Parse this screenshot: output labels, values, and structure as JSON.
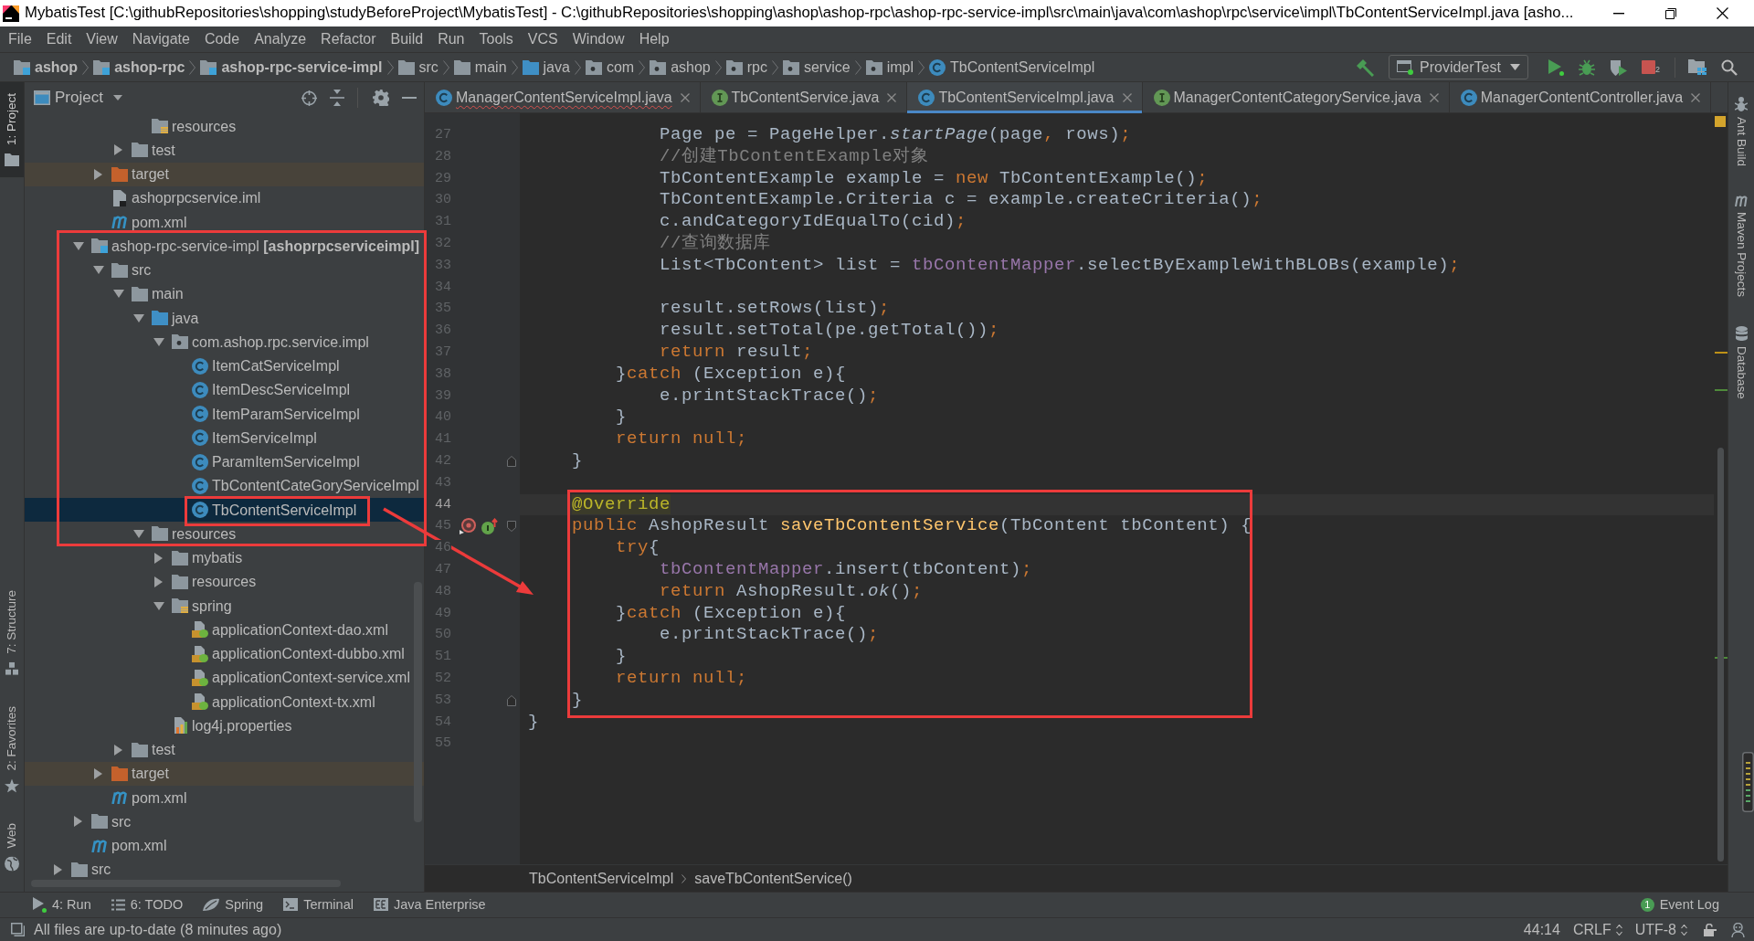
{
  "window": {
    "title": "MybatisTest [C:\\githubRepositories\\shopping\\studyBeforeProject\\MybatisTest] - C:\\githubRepositories\\shopping\\ashop\\ashop-rpc\\ashop-rpc-service-impl\\src\\main\\java\\com\\ashop\\rpc\\service\\impl\\TbContentServiceImpl.java [asho..."
  },
  "menu": [
    "File",
    "Edit",
    "View",
    "Navigate",
    "Code",
    "Analyze",
    "Refactor",
    "Build",
    "Run",
    "Tools",
    "VCS",
    "Window",
    "Help"
  ],
  "navigation_bar": {
    "path": [
      {
        "label": "ashop",
        "kind": "module"
      },
      {
        "label": "ashop-rpc",
        "kind": "module"
      },
      {
        "label": "ashop-rpc-service-impl",
        "kind": "module"
      },
      {
        "label": "src",
        "kind": "folder"
      },
      {
        "label": "main",
        "kind": "folder"
      },
      {
        "label": "java",
        "kind": "source-root"
      },
      {
        "label": "com",
        "kind": "package"
      },
      {
        "label": "ashop",
        "kind": "package"
      },
      {
        "label": "rpc",
        "kind": "package"
      },
      {
        "label": "service",
        "kind": "package"
      },
      {
        "label": "impl",
        "kind": "package"
      },
      {
        "label": "TbContentServiceImpl",
        "kind": "class"
      }
    ]
  },
  "toolbar": {
    "run_configuration": "ProviderTest",
    "running_count": "2"
  },
  "left_tool_strip": [
    {
      "label": "1: Project",
      "kind": "project",
      "selected": true
    },
    {
      "label": "7: Structure",
      "kind": "structure",
      "selected": false
    },
    {
      "label": "2: Favorites",
      "kind": "favorites",
      "selected": false
    },
    {
      "label": "Web",
      "kind": "web",
      "selected": false
    }
  ],
  "project_panel": {
    "title": "Project",
    "tree": [
      {
        "children": [
          {
            "children": [
              {
                "children": [
                  {
                    "children": [
                      {
                        "children": [
                          {
                            "children": [
                              {
                                "label": "resources",
                                "kind": "resource-root",
                                "selected": false
                              }
                            ]
                          },
                          {
                            "label": "test",
                            "kind": "folder",
                            "expanded": false,
                            "selected": false
                          }
                        ]
                      },
                      {
                        "label": "target",
                        "kind": "excluded",
                        "expanded": false,
                        "selected": false
                      },
                      {
                        "label": "ashoprpcservice.iml",
                        "kind": "iml",
                        "selected": false
                      },
                      {
                        "label": "pom.xml",
                        "kind": "pom",
                        "selected": false
                      }
                    ]
                  },
                  {
                    "label": "ashop-rpc-service-impl **[ashoprpcserviceimpl]**",
                    "kind": "module",
                    "expanded": true,
                    "selected": false,
                    "children": [
                      {
                        "label": "src",
                        "kind": "folder",
                        "expanded": true,
                        "selected": false,
                        "children": [
                          {
                            "label": "main",
                            "kind": "folder",
                            "expanded": true,
                            "selected": false,
                            "children": [
                              {
                                "label": "java",
                                "kind": "source-root",
                                "expanded": true,
                                "selected": false,
                                "children": [
                                  {
                                    "label": "com.ashop.rpc.service.impl",
                                    "kind": "package",
                                    "expanded": true,
                                    "selected": false,
                                    "children": [
                                      {
                                        "label": "ItemCatServiceImpl",
                                        "kind": "class",
                                        "selected": false
                                      },
                                      {
                                        "label": "ItemDescServiceImpl",
                                        "kind": "class",
                                        "selected": false
                                      },
                                      {
                                        "label": "ItemParamServiceImpl",
                                        "kind": "class",
                                        "selected": false
                                      },
                                      {
                                        "label": "ItemServiceImpl",
                                        "kind": "class",
                                        "selected": false
                                      },
                                      {
                                        "label": "ParamItemServiceImpl",
                                        "kind": "class",
                                        "selected": false
                                      },
                                      {
                                        "label": "TbContentCateGoryServiceImpl",
                                        "kind": "class",
                                        "selected": false
                                      },
                                      {
                                        "label": "TbContentServiceImpl",
                                        "kind": "class",
                                        "selected": true
                                      }
                                    ]
                                  }
                                ]
                              },
                              {
                                "label": "resources",
                                "kind": "folder",
                                "expanded": true,
                                "selected": false,
                                "children": [
                                  {
                                    "label": "mybatis",
                                    "kind": "folder",
                                    "expanded": false,
                                    "selected": false
                                  },
                                  {
                                    "label": "resources",
                                    "kind": "folder",
                                    "expanded": false,
                                    "selected": false
                                  },
                                  {
                                    "label": "spring",
                                    "kind": "resource-root",
                                    "expanded": true,
                                    "selected": false,
                                    "children": [
                                      {
                                        "label": "applicationContext-dao.xml",
                                        "kind": "spring-xml",
                                        "selected": false
                                      },
                                      {
                                        "label": "applicationContext-dubbo.xml",
                                        "kind": "spring-xml",
                                        "selected": false
                                      },
                                      {
                                        "label": "applicationContext-service.xml",
                                        "kind": "spring-xml",
                                        "selected": false
                                      },
                                      {
                                        "label": "applicationContext-tx.xml",
                                        "kind": "spring-xml",
                                        "selected": false
                                      }
                                    ]
                                  },
                                  {
                                    "label": "log4j.properties",
                                    "kind": "properties",
                                    "selected": false
                                  }
                                ]
                              }
                            ]
                          },
                          {
                            "label": "test",
                            "kind": "folder",
                            "expanded": false,
                            "selected": false
                          }
                        ]
                      },
                      {
                        "label": "target",
                        "kind": "excluded",
                        "expanded": false,
                        "selected": false
                      },
                      {
                        "label": "pom.xml",
                        "kind": "pom",
                        "selected": false
                      }
                    ]
                  },
                  {
                    "label": "src",
                    "kind": "folder",
                    "expanded": false,
                    "selected": false
                  },
                  {
                    "label": "pom.xml",
                    "kind": "pom",
                    "selected": false
                  }
                ]
              },
              {
                "label": "src",
                "kind": "folder",
                "expanded": false,
                "selected": false
              }
            ]
          }
        ]
      }
    ]
  },
  "editor": {
    "tabs": [
      {
        "label": "ManagerContentServiceImpl.java",
        "kind": "class",
        "selected": false,
        "error": true
      },
      {
        "label": "TbContentService.java",
        "kind": "interface",
        "selected": false,
        "error": false
      },
      {
        "label": "TbContentServiceImpl.java",
        "kind": "class",
        "selected": true,
        "error": false
      },
      {
        "label": "ManagerContentCategoryService.java",
        "kind": "interface",
        "selected": false,
        "error": false
      },
      {
        "label": "ManagerContentController.java",
        "kind": "class",
        "selected": false,
        "error": false
      }
    ],
    "lines": [
      {
        "number": "27",
        "current": false,
        "tokens": [
          {
            "kind": "plain",
            "text": "            Page pe = PageHelper."
          },
          {
            "kind": "static-call",
            "text": "startPage"
          },
          {
            "kind": "plain",
            "text": "(page"
          },
          {
            "kind": "punctuation",
            "text": ","
          },
          {
            "kind": "plain",
            "text": " rows)"
          },
          {
            "kind": "punctuation",
            "text": ";"
          }
        ]
      },
      {
        "number": "28",
        "current": false,
        "tokens": [
          {
            "kind": "comment",
            "text": "            //创建TbContentExample对象"
          }
        ]
      },
      {
        "number": "29",
        "current": false,
        "tokens": [
          {
            "kind": "plain",
            "text": "            TbContentExample example = "
          },
          {
            "kind": "keyword",
            "text": "new"
          },
          {
            "kind": "plain",
            "text": " TbContentExample()"
          },
          {
            "kind": "punctuation",
            "text": ";"
          }
        ]
      },
      {
        "number": "30",
        "current": false,
        "tokens": [
          {
            "kind": "plain",
            "text": "            TbContentExample.Criteria c = example.createCriteria()"
          },
          {
            "kind": "punctuation",
            "text": ";"
          }
        ]
      },
      {
        "number": "31",
        "current": false,
        "tokens": [
          {
            "kind": "plain",
            "text": "            c.andCategoryIdEqualTo(cid)"
          },
          {
            "kind": "punctuation",
            "text": ";"
          }
        ]
      },
      {
        "number": "32",
        "current": false,
        "tokens": [
          {
            "kind": "comment",
            "text": "            //查询数据库"
          }
        ]
      },
      {
        "number": "33",
        "current": false,
        "tokens": [
          {
            "kind": "plain",
            "text": "            List<TbContent> list = "
          },
          {
            "kind": "field",
            "text": "tbContentMapper"
          },
          {
            "kind": "plain",
            "text": ".selectByExampleWithBLOBs(example)"
          },
          {
            "kind": "punctuation",
            "text": ";"
          }
        ]
      },
      {
        "number": "34",
        "current": false
      },
      {
        "number": "35",
        "current": false,
        "tokens": [
          {
            "kind": "plain",
            "text": "            result.setRows(list)"
          },
          {
            "kind": "punctuation",
            "text": ";"
          }
        ]
      },
      {
        "number": "36",
        "current": false,
        "tokens": [
          {
            "kind": "plain",
            "text": "            result.setTotal(pe.getTotal())"
          },
          {
            "kind": "punctuation",
            "text": ";"
          }
        ]
      },
      {
        "number": "37",
        "current": false,
        "tokens": [
          {
            "kind": "keyword",
            "text": "            return"
          },
          {
            "kind": "plain",
            "text": " result"
          },
          {
            "kind": "punctuation",
            "text": ";"
          }
        ]
      },
      {
        "number": "38",
        "current": false,
        "tokens": [
          {
            "kind": "plain",
            "text": "        }"
          },
          {
            "kind": "keyword",
            "text": "catch"
          },
          {
            "kind": "plain",
            "text": " (Exception e){"
          }
        ]
      },
      {
        "number": "39",
        "current": false,
        "tokens": [
          {
            "kind": "plain",
            "text": "            e.printStackTrace()"
          },
          {
            "kind": "punctuation",
            "text": ";"
          }
        ]
      },
      {
        "number": "40",
        "current": false,
        "tokens": [
          {
            "kind": "plain",
            "text": "        }"
          }
        ]
      },
      {
        "number": "41",
        "current": false,
        "tokens": [
          {
            "kind": "keyword",
            "text": "        return null"
          },
          {
            "kind": "punctuation",
            "text": ";"
          }
        ]
      },
      {
        "number": "42",
        "current": false,
        "gutter": [
          {
            "kind": "fold-end"
          }
        ],
        "tokens": [
          {
            "kind": "plain",
            "text": "    }"
          }
        ]
      },
      {
        "number": "43",
        "current": false
      },
      {
        "number": "44",
        "current": true,
        "tokens": [
          {
            "kind": "annotation",
            "text": "    @Override"
          }
        ]
      },
      {
        "number": "45",
        "current": false,
        "gutter": [
          {
            "kind": "marker"
          },
          {
            "kind": "implements"
          },
          {
            "kind": "fold-start"
          }
        ],
        "tokens": [
          {
            "kind": "keyword",
            "text": "    public"
          },
          {
            "kind": "plain",
            "text": " AshopResult "
          },
          {
            "kind": "declaration",
            "text": "saveTbContentService"
          },
          {
            "kind": "plain",
            "text": "(TbContent tbContent) {"
          }
        ]
      },
      {
        "number": "46",
        "current": false,
        "tokens": [
          {
            "kind": "keyword",
            "text": "        try"
          },
          {
            "kind": "plain",
            "text": "{"
          }
        ]
      },
      {
        "number": "47",
        "current": false,
        "tokens": [
          {
            "kind": "field",
            "text": "            tbContentMapper"
          },
          {
            "kind": "plain",
            "text": ".insert(tbContent)"
          },
          {
            "kind": "punctuation",
            "text": ";"
          }
        ]
      },
      {
        "number": "48",
        "current": false,
        "tokens": [
          {
            "kind": "keyword",
            "text": "            return"
          },
          {
            "kind": "plain",
            "text": " AshopResult."
          },
          {
            "kind": "static-call",
            "text": "ok"
          },
          {
            "kind": "plain",
            "text": "()"
          },
          {
            "kind": "punctuation",
            "text": ";"
          }
        ]
      },
      {
        "number": "49",
        "current": false,
        "tokens": [
          {
            "kind": "plain",
            "text": "        }"
          },
          {
            "kind": "keyword",
            "text": "catch"
          },
          {
            "kind": "plain",
            "text": " (Exception e){"
          }
        ]
      },
      {
        "number": "50",
        "current": false,
        "tokens": [
          {
            "kind": "plain",
            "text": "            e.printStackTrace()"
          },
          {
            "kind": "punctuation",
            "text": ";"
          }
        ]
      },
      {
        "number": "51",
        "current": false,
        "tokens": [
          {
            "kind": "plain",
            "text": "        }"
          }
        ]
      },
      {
        "number": "52",
        "current": false,
        "tokens": [
          {
            "kind": "keyword",
            "text": "        return null"
          },
          {
            "kind": "punctuation",
            "text": ";"
          }
        ]
      },
      {
        "number": "53",
        "current": false,
        "gutter": [
          {
            "kind": "fold-end"
          }
        ],
        "tokens": [
          {
            "kind": "plain",
            "text": "    }"
          }
        ]
      },
      {
        "number": "54",
        "current": false,
        "tokens": [
          {
            "kind": "plain",
            "text": "}"
          }
        ]
      },
      {
        "number": "55",
        "current": false
      }
    ],
    "breadcrumb": [
      "TbContentServiceImpl",
      "saveTbContentService()"
    ]
  },
  "right_tool_strip": [
    {
      "label": "Ant Build",
      "kind": "ant",
      "selected": false
    },
    {
      "label": "Maven Projects",
      "kind": "maven",
      "selected": false
    },
    {
      "label": "Database",
      "kind": "database",
      "selected": false
    }
  ],
  "tool_window_bar": {
    "buttons": [
      {
        "label": "4: Run",
        "kind": "run"
      },
      {
        "label": "6: TODO",
        "kind": "todo"
      },
      {
        "label": "Spring",
        "kind": "spring"
      },
      {
        "label": "Terminal",
        "kind": "terminal"
      },
      {
        "label": "Java Enterprise",
        "kind": "java-enterprise"
      }
    ],
    "event_log": {
      "label": "Event Log",
      "count": "1"
    }
  },
  "status_bar": {
    "message": "All files are up-to-date (8 minutes ago)",
    "caret_position": "44:14",
    "line_separator": "CRLF",
    "encoding": "UTF-8"
  },
  "annotations": [
    {
      "kind": "frame"
    },
    {
      "kind": "frame"
    },
    {
      "kind": "arrow"
    },
    {
      "kind": "frame"
    }
  ]
}
